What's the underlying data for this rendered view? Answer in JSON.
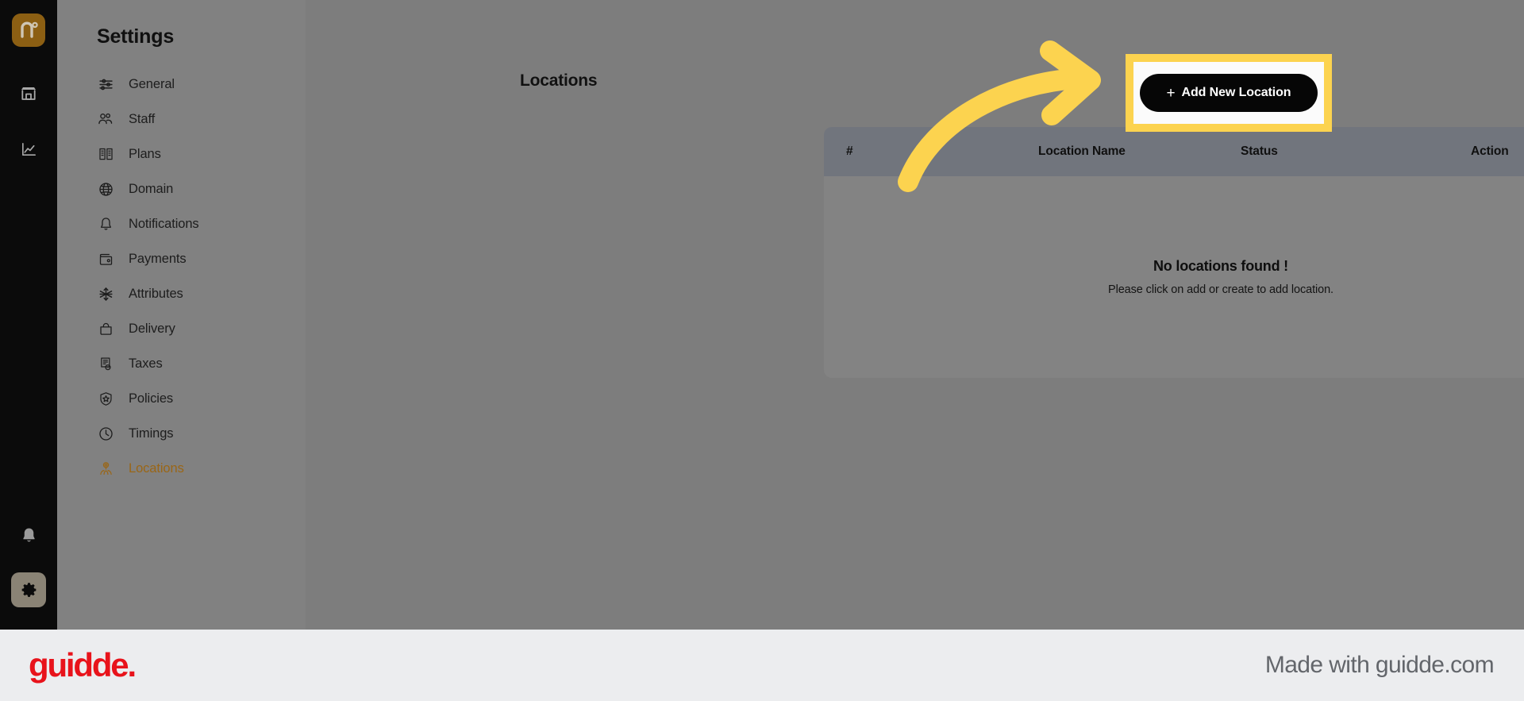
{
  "rail": {
    "brand_icon": "n-degree-logo-icon",
    "brand_color": "#8c5f13",
    "items": [
      {
        "name": "store-icon",
        "label": "Store"
      },
      {
        "name": "analytics-icon",
        "label": "Analytics"
      }
    ],
    "bottom_items": [
      {
        "name": "bell-icon",
        "label": "Notifications"
      },
      {
        "name": "gear-icon",
        "label": "Settings"
      }
    ]
  },
  "sidebar": {
    "title": "Settings",
    "active_color": "#9a6616",
    "items": [
      {
        "label": "General",
        "icon": "sliders-icon",
        "active": false
      },
      {
        "label": "Staff",
        "icon": "users-group-icon",
        "active": false
      },
      {
        "label": "Plans",
        "icon": "building-plan-icon",
        "active": false
      },
      {
        "label": "Domain",
        "icon": "globe-icon",
        "active": false
      },
      {
        "label": "Notifications",
        "icon": "bell-icon",
        "active": false
      },
      {
        "label": "Payments",
        "icon": "wallet-icon",
        "active": false
      },
      {
        "label": "Attributes",
        "icon": "asterisk-icon",
        "active": false
      },
      {
        "label": "Delivery",
        "icon": "bag-icon",
        "active": false
      },
      {
        "label": "Taxes",
        "icon": "tax-document-icon",
        "active": false
      },
      {
        "label": "Policies",
        "icon": "shield-icon",
        "active": false
      },
      {
        "label": "Timings",
        "icon": "clock-icon",
        "active": false
      },
      {
        "label": "Locations",
        "icon": "map-pin-people-icon",
        "active": true
      }
    ]
  },
  "main": {
    "heading": "Locations",
    "add_button": {
      "plus": "+",
      "label": "Add New Location"
    },
    "table": {
      "columns": [
        "#",
        "Location Name",
        "Status",
        "Action"
      ],
      "rows": [],
      "empty_title": "No locations found !",
      "empty_subtitle": "Please click on add or create to add location."
    }
  },
  "annotation": {
    "highlight_color": "#fcd34f",
    "arrow_color": "#fcd34f",
    "arrow_name": "curved-arrow-pointing-to-add-new-location"
  },
  "footer": {
    "logo_text": "guidde.",
    "logo_color": "#e8131b",
    "made_with": "Made with guidde.com"
  }
}
